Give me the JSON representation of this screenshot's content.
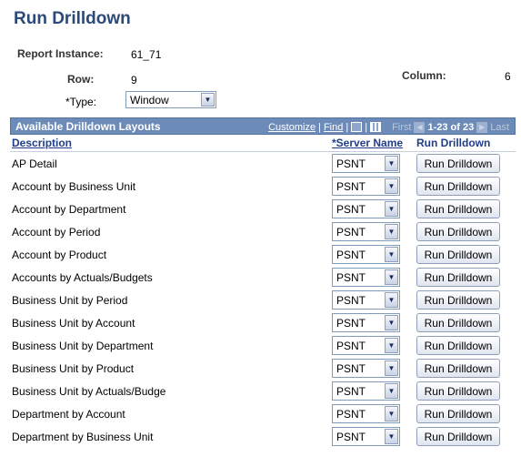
{
  "page": {
    "title": "Run Drilldown"
  },
  "fields": {
    "report_instance_label": "Report Instance:",
    "report_instance_value": "61_71",
    "row_label": "Row:",
    "row_value": "9",
    "column_label": "Column:",
    "column_value": "6",
    "type_label": "*Type:",
    "type_value": "Window"
  },
  "grid": {
    "title": "Available Drilldown Layouts",
    "customize": "Customize",
    "find": "Find",
    "first": "First",
    "range": "1-23 of 23",
    "last": "Last",
    "columns": {
      "description": "Description",
      "server_name": "*Server Name",
      "run_drilldown": "Run Drilldown"
    },
    "rows": [
      {
        "description": "AP Detail",
        "server": "PSNT",
        "button": "Run Drilldown"
      },
      {
        "description": "Account by Business Unit",
        "server": "PSNT",
        "button": "Run Drilldown"
      },
      {
        "description": "Account by Department",
        "server": "PSNT",
        "button": "Run Drilldown"
      },
      {
        "description": "Account by Period",
        "server": "PSNT",
        "button": "Run Drilldown"
      },
      {
        "description": "Account by Product",
        "server": "PSNT",
        "button": "Run Drilldown"
      },
      {
        "description": "Accounts by Actuals/Budgets",
        "server": "PSNT",
        "button": "Run Drilldown"
      },
      {
        "description": "Business Unit by Period",
        "server": "PSNT",
        "button": "Run Drilldown"
      },
      {
        "description": "Business Unit by Account",
        "server": "PSNT",
        "button": "Run Drilldown"
      },
      {
        "description": "Business Unit by Department",
        "server": "PSNT",
        "button": "Run Drilldown"
      },
      {
        "description": "Business Unit by Product",
        "server": "PSNT",
        "button": "Run Drilldown"
      },
      {
        "description": "Business Unit by Actuals/Budge",
        "server": "PSNT",
        "button": "Run Drilldown"
      },
      {
        "description": "Department by Account",
        "server": "PSNT",
        "button": "Run Drilldown"
      },
      {
        "description": "Department by Business Unit",
        "server": "PSNT",
        "button": "Run Drilldown"
      }
    ]
  },
  "icons": {
    "view_all": "new-window-icon",
    "download": "grid-download-icon",
    "prev": "prev-arrow-icon",
    "next": "next-arrow-icon",
    "dropdown": "chevron-down-icon"
  },
  "colors": {
    "title": "#2b4a78",
    "grid_header": "#6d8bb8",
    "link": "#1f3d8a"
  }
}
